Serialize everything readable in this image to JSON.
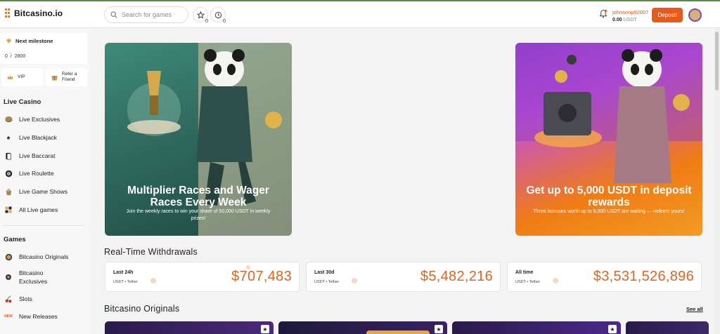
{
  "brand": {
    "name": "Bitcasino.io"
  },
  "search": {
    "placeholder": "Search for games"
  },
  "header": {
    "favorites_count": "0",
    "recent_count": "0",
    "username": "johnsonp92007",
    "balance_value": "0.00",
    "balance_currency": "USDT",
    "deposit_label": "Deposit"
  },
  "sidebar": {
    "milestone_title": "Next milestone",
    "milestone_current": "0",
    "milestone_sep": "/",
    "milestone_target": "2800",
    "vip_label": "VIP",
    "refer_label_1": "Refer a",
    "refer_label_2": "Friend",
    "live_casino_title": "Live Casino",
    "live_items": [
      {
        "label": "Live Exclusives",
        "icon": "chip-icon"
      },
      {
        "label": "Live Blackjack",
        "icon": "spade-icon"
      },
      {
        "label": "Live Baccarat",
        "icon": "cards-icon"
      },
      {
        "label": "Live Roulette",
        "icon": "roulette-icon"
      },
      {
        "label": "Live Game Shows",
        "icon": "gameshow-icon"
      },
      {
        "label": "All Live games",
        "icon": "grid-icon"
      }
    ],
    "games_title": "Games",
    "games_items": [
      {
        "label": "Bitcasino Originals",
        "icon": "originals-icon"
      },
      {
        "label_1": "Bitcasino",
        "label_2": "Exclusives",
        "icon": "exclusives-icon"
      },
      {
        "label": "Slots",
        "icon": "cherries-icon"
      },
      {
        "label": "New Releases",
        "icon": "new-badge-icon",
        "badge": "NEW"
      }
    ]
  },
  "banners": [
    {
      "title": "Multiplier Races and Wager Races Every Week",
      "subtitle": "Join the weekly races to win your share of 50,000 USDT in weekly prizes!"
    },
    {
      "title": "Get up to 5,000 USDT in deposit rewards",
      "subtitle": "Three bonuses worth up to 5,000 USDT are waiting — redeem yours!"
    }
  ],
  "withdrawals": {
    "title": "Real-Time Withdrawals",
    "cards": [
      {
        "label": "Last 24h",
        "currency": "USDT • Tether",
        "value": "$707,483"
      },
      {
        "label": "Last 30d",
        "currency": "USDT • Tether",
        "value": "$5,482,216"
      },
      {
        "label": "All time",
        "currency": "USDT • Tether",
        "value": "$3,531,526,896"
      }
    ]
  },
  "originals": {
    "title": "Bitcasino Originals",
    "see_all": "See all"
  },
  "colors": {
    "accent": "#e75a1b",
    "value_orange": "#e06420",
    "banner1_bg": "#2f6a5d",
    "banner2_bg": "#f07c14"
  }
}
